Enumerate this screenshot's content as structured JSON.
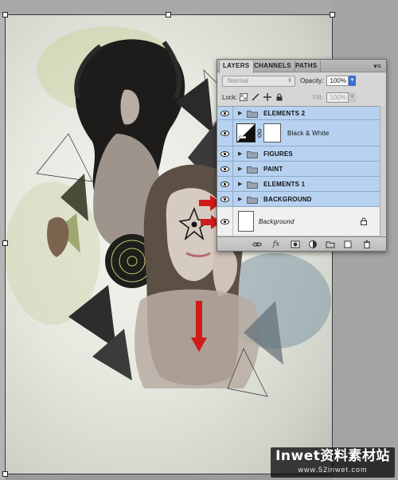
{
  "panel": {
    "tabs": [
      "LAYERS",
      "CHANNELS",
      "PATHS"
    ],
    "menu_icon": "panel-menu-icon",
    "blend_mode": "Normal",
    "opacity_label": "Opacity:",
    "opacity_value": "100%",
    "lock_label": "Lock:",
    "fill_label": "Fill:",
    "fill_value": "100%",
    "layers": [
      {
        "name": "ELEMENTS 2",
        "kind": "group",
        "selected": true
      },
      {
        "name": "Black & White",
        "kind": "adjustment",
        "selected": true
      },
      {
        "name": "FIGURES",
        "kind": "group",
        "selected": true
      },
      {
        "name": "PAINT",
        "kind": "group",
        "selected": true
      },
      {
        "name": "ELEMENTS 1",
        "kind": "group",
        "selected": true
      },
      {
        "name": "BACKGROUND",
        "kind": "group",
        "selected": true
      },
      {
        "name": "Background",
        "kind": "background",
        "selected": false
      }
    ],
    "footer_icons": [
      "link-layers-icon",
      "fx-icon",
      "add-mask-icon",
      "adjustment-layer-icon",
      "new-group-icon",
      "new-layer-icon",
      "trash-icon"
    ],
    "fx_label": "fx"
  },
  "watermark": {
    "main": "Inwet资料素材站",
    "sub": "www.52inwet.com"
  },
  "colors": {
    "selected_row": "#b7d2f1",
    "accent_blue": "#3b6fd6",
    "arrow_red": "#d11a1a"
  }
}
